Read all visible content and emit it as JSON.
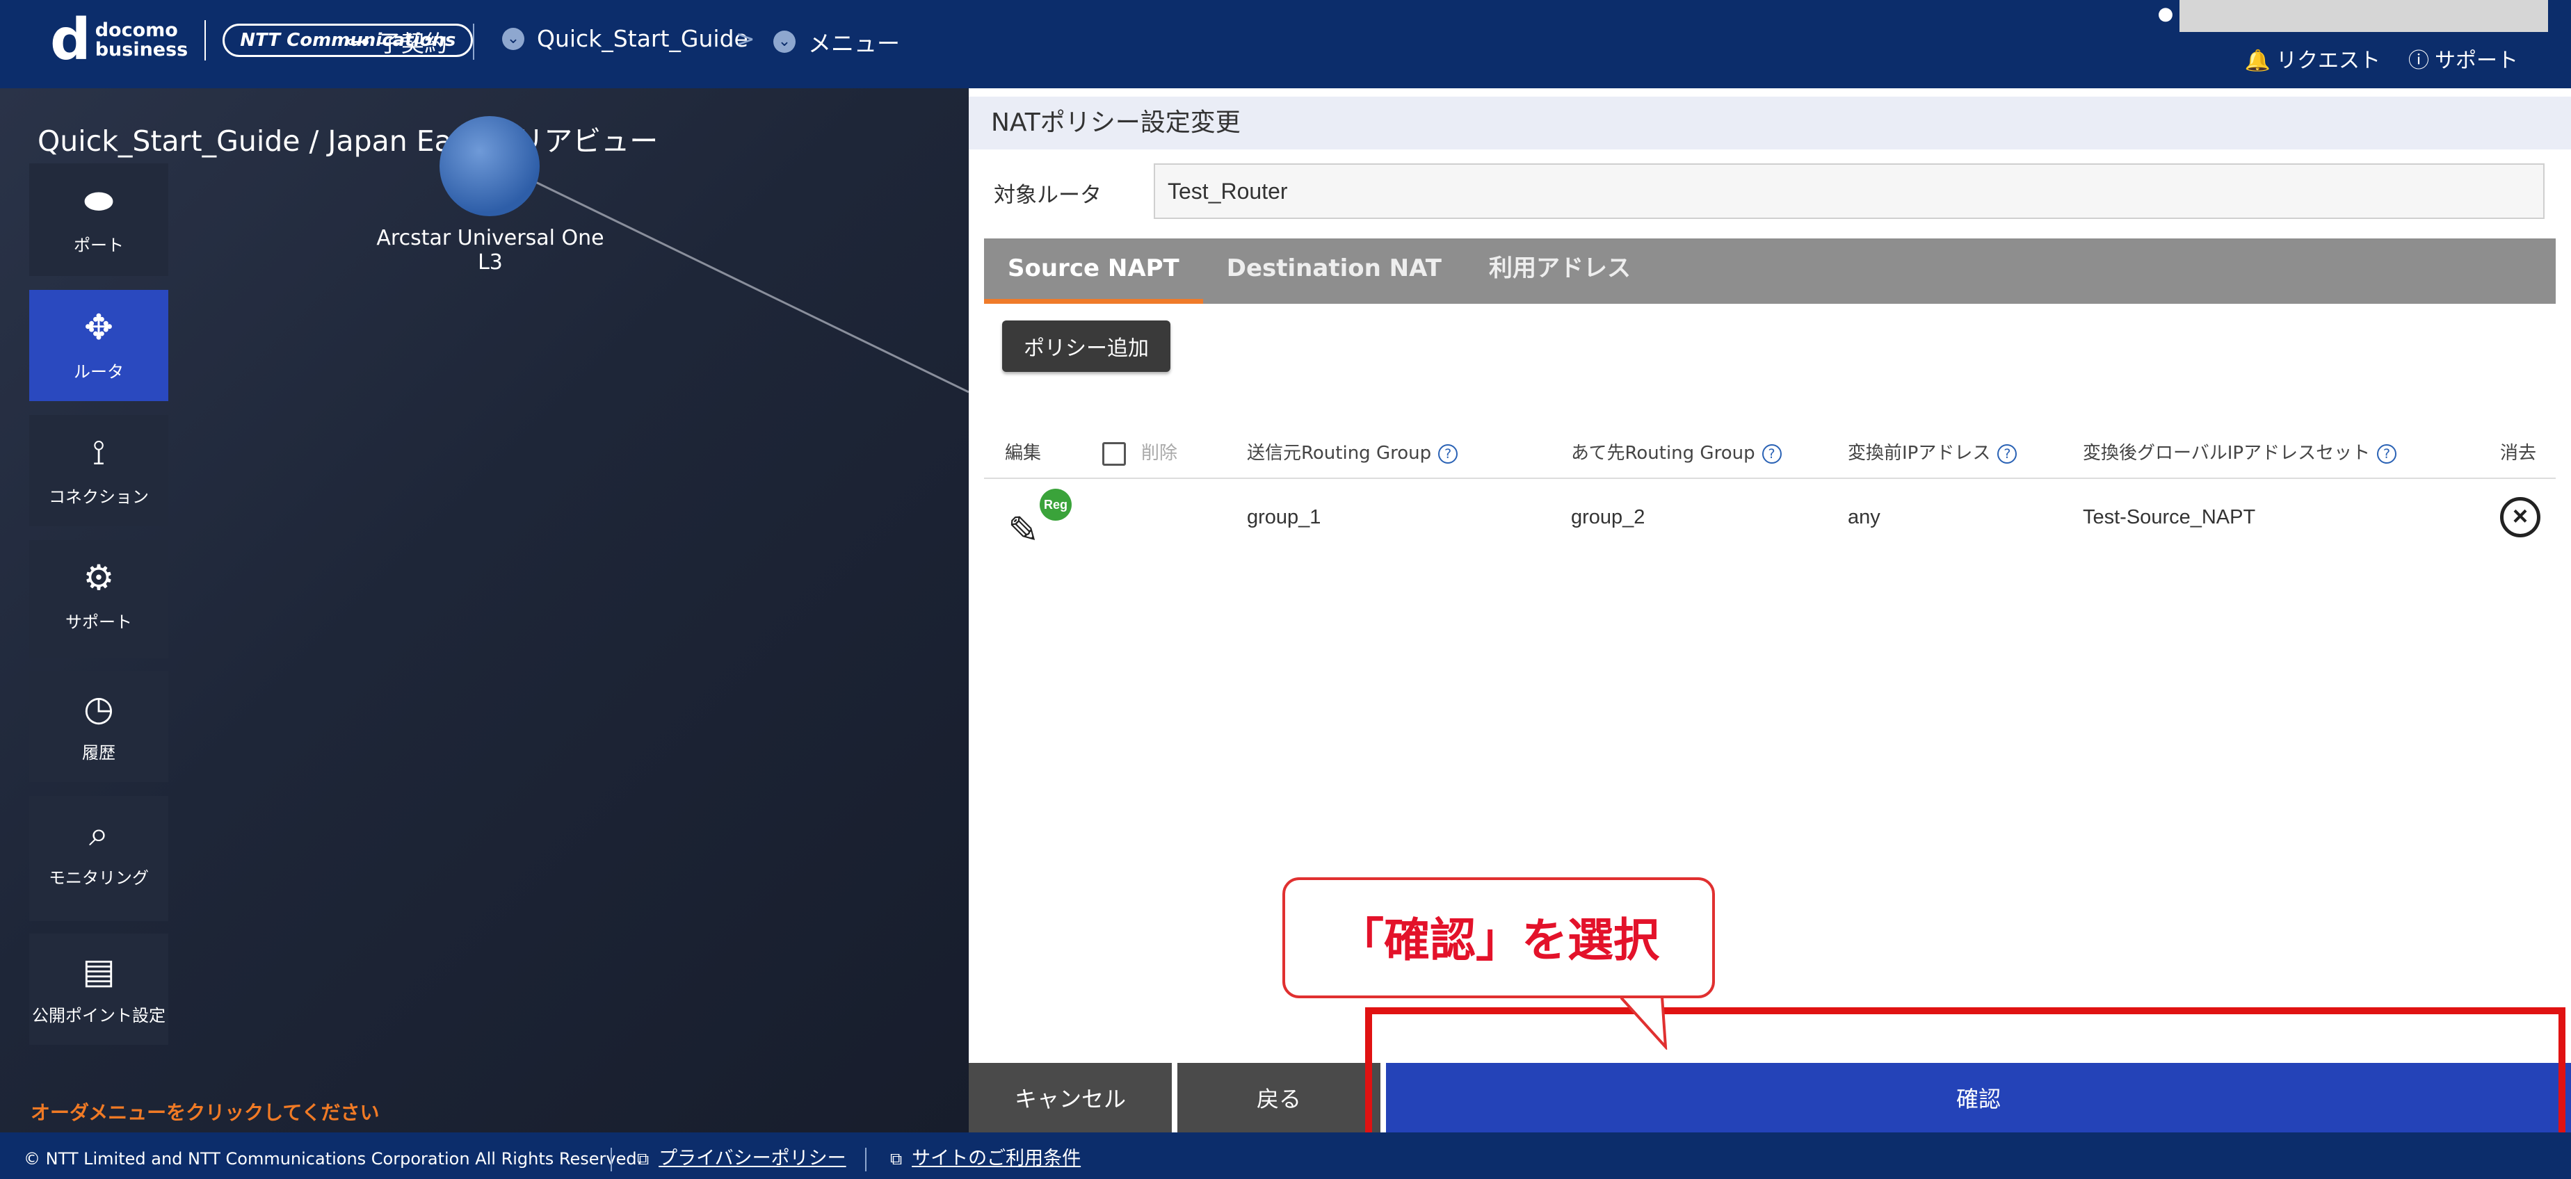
{
  "header": {
    "logo_d": "d",
    "logo_line1": "docomo",
    "logo_line2": "business",
    "logo_ntt": "NTT Communications",
    "contract": "子契約",
    "breadcrumb_1": "Quick_Start_Guide",
    "breadcrumb_sep": ">",
    "breadcrumb_2": "メニュー",
    "request": "リクエスト",
    "support": "サポート"
  },
  "map": {
    "title": "Quick_Start_Guide / Japan East エリアビュー",
    "node_label": "Arcstar Universal One L3",
    "order_message": "オーダメニューをクリックしてください"
  },
  "sidemenu": [
    {
      "label": "ポート",
      "icon": "port-icon"
    },
    {
      "label": "ルータ",
      "icon": "router-icon",
      "active": true
    },
    {
      "label": "コネクション",
      "icon": "connection-icon"
    },
    {
      "label": "サポート",
      "icon": "support-icon"
    },
    {
      "label": "履歴",
      "icon": "history-icon"
    },
    {
      "label": "モニタリング",
      "icon": "monitoring-icon"
    },
    {
      "label": "公開ポイント設定",
      "icon": "public-point-icon"
    }
  ],
  "panel": {
    "title": "NATポリシー設定変更",
    "target_label": "対象ルータ",
    "target_value": "Test_Router",
    "tabs": [
      "Source NAPT",
      "Destination NAT",
      "利用アドレス"
    ],
    "add_button": "ポリシー追加",
    "columns": {
      "edit": "編集",
      "delete": "削除",
      "src_group": "送信元Routing Group",
      "dst_group": "あて先Routing Group",
      "pre_ip": "変換前IPアドレス",
      "post_ip_set": "変換後グローバルIPアドレスセット",
      "remove": "消去"
    },
    "rows": [
      {
        "badge": "Reg",
        "src_group": "group_1",
        "dst_group": "group_2",
        "pre_ip": "any",
        "post_ip_set": "Test-Source_NAPT"
      }
    ],
    "buttons": {
      "cancel": "キャンセル",
      "back": "戻る",
      "confirm": "確認"
    }
  },
  "annotation": {
    "callout": "「確認」を選択",
    "color": "#e3122a"
  },
  "footer": {
    "copyright": "© NTT Limited and NTT Communications Corporation All Rights Reserved.",
    "privacy": "プライバシーポリシー",
    "terms": "サイトのご利用条件"
  },
  "colors": {
    "header_bg": "#0c2d6b",
    "accent_blue": "#2443b8",
    "tab_underline": "#ef7b2a",
    "order_text": "#f07a25"
  }
}
